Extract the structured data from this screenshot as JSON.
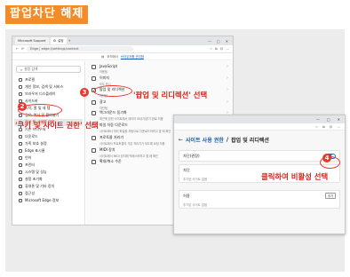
{
  "page_title": "팝업차단 해제",
  "browser": {
    "tabs": [
      "Microsoft Support",
      "설정"
    ],
    "url": "Edge | edge://settings/content",
    "infobar_text": "조직에서",
    "infobar_link": "브라우저를 관리함",
    "window_controls": [
      "—",
      "□",
      "✕"
    ]
  },
  "sidebar": {
    "search_placeholder": "설정 검색",
    "items": [
      {
        "label": "프로필",
        "icon": "profile-icon"
      },
      {
        "label": "개인 정보, 검색 및 서비스",
        "icon": "lock-icon"
      },
      {
        "label": "브라우저 디스플레이",
        "icon": "display-icon"
      },
      {
        "label": "사이드바",
        "icon": "sidebar-icon"
      },
      {
        "label": "시작, 홈 및 새 탭",
        "icon": "home-icon"
      },
      {
        "label": "공유, 복사 및 붙여넣기",
        "icon": "share-icon"
      },
      {
        "label": "쿠키 및 사이트 권한",
        "icon": "cookie-icon",
        "active": true
      },
      {
        "label": "기본 브라우저",
        "icon": "browser-icon"
      },
      {
        "label": "다운로드",
        "icon": "download-icon"
      },
      {
        "label": "가족 보호 설정",
        "icon": "family-icon"
      },
      {
        "label": "Edge 표시줄",
        "icon": "edge-bar-icon"
      },
      {
        "label": "언어",
        "icon": "language-icon"
      },
      {
        "label": "프린터",
        "icon": "printer-icon"
      },
      {
        "label": "시스템 및 성능",
        "icon": "system-icon"
      },
      {
        "label": "설정 초기화",
        "icon": "reset-icon"
      },
      {
        "label": "휴대폰 및 기타 장치",
        "icon": "phone-icon"
      },
      {
        "label": "접근성",
        "icon": "accessibility-icon"
      },
      {
        "label": "Microsoft Edge 정보",
        "icon": "edge-icon"
      }
    ]
  },
  "content_rows": [
    {
      "title": "JavaScript",
      "sub": "허용됨"
    },
    {
      "title": "이미지",
      "sub": "모두 표시"
    },
    {
      "title": "팝업 및 리디렉션",
      "sub": "차단됨"
    },
    {
      "title": "광고",
      "sub": "차단됨"
    },
    {
      "title": "백그라운드 동기화",
      "sub": "최근에 닫힌 사이트에서 데이터 보내기/받기 완료 허용"
    },
    {
      "title": "파일 자동 다운로드",
      "sub": "사이트에서 여러 파일을 자동으로 다운로드하려고 할 때 확인"
    },
    {
      "title": "프로토콜 처리기",
      "sub": "사이트에서 프로토콜의 기본 처리기가 되도록 요청 허용"
    },
    {
      "title": "MIDI 장치",
      "sub": "사이트에서 MIDI 장치에 액세스하려고 할 때 확인"
    },
    {
      "title": "확대/축소 수준",
      "sub": ""
    }
  ],
  "overlay": {
    "heading_prefix": "사이트 사용 권한",
    "heading_title": "팝업 및 리디렉션",
    "toggle_label": "차단(권장)",
    "block_label": "차단",
    "block_empty": "추가된 사이트 없음",
    "allow_label": "허용",
    "allow_add": "추가",
    "allow_empty": "추가된 사이트 없음",
    "add_button": "추가"
  },
  "annotations": {
    "step2_num": "2",
    "step2_text": "'쿠키 및 사이트 권한' 선택",
    "step3_num": "3",
    "step3_text": "'팝업 및 리디렉션' 선택",
    "step4_num": "4",
    "step4_text": "클릭하여 비활성 선택"
  },
  "colors": {
    "accent": "#f28c28",
    "annotation_red": "#e8392d",
    "toggle_blue": "#1a6fd1"
  }
}
